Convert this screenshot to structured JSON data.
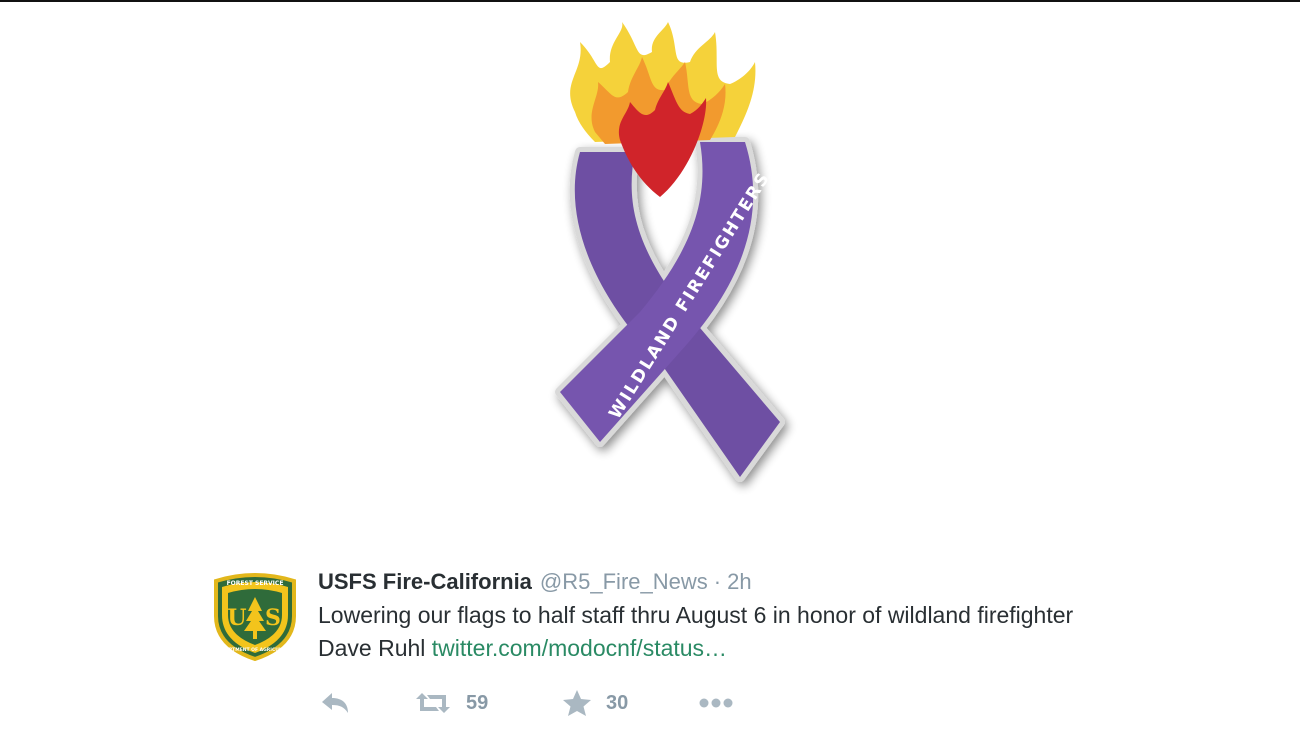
{
  "ribbon": {
    "text": "WILDLAND FIREFIGHTERS",
    "ribbon_color": "#6e4fa3",
    "flame_colors": [
      "#f5d23a",
      "#f29a2e",
      "#d0242a"
    ]
  },
  "tweet": {
    "display_name": "USFS Fire-California",
    "handle": "@R5_Fire_News",
    "separator": "·",
    "timestamp": "2h",
    "text": "Lowering our flags to half staff thru August 6 in honor of wildland firefighter Dave Ruhl ",
    "link_text": "twitter.com/modocnf/status…",
    "avatar": {
      "top_text": "FOREST SERVICE",
      "initials_left": "U",
      "initials_right": "S",
      "bottom_text": "DEPARTMENT OF AGRICULTURE"
    },
    "actions": {
      "reply_icon": "reply-icon",
      "retweet_icon": "retweet-icon",
      "retweet_count": "59",
      "favorite_icon": "star-icon",
      "favorite_count": "30",
      "more_icon": "more-icon"
    }
  },
  "colors": {
    "name": "#292f33",
    "meta": "#8899a6",
    "link": "#2a8a64",
    "action_icon": "#aab8c2"
  }
}
